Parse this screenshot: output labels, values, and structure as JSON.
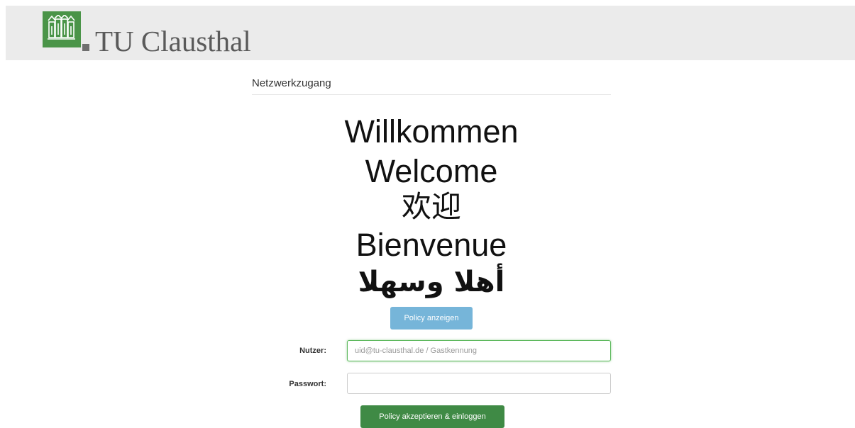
{
  "header": {
    "brand": "TU Clausthal",
    "logo_icon": "tu-clausthal-logo-icon",
    "logo_color": "#4a9448",
    "background": "#ebebeb"
  },
  "main": {
    "section_title": "Netzwerkzugang",
    "welcome": [
      "Willkommen",
      "Welcome",
      "欢迎",
      "Bienvenue",
      "أهلا وسهلا"
    ],
    "policy_button": "Policy anzeigen",
    "user_label": "Nutzer:",
    "user_placeholder": "uid@tu-clausthal.de / Gastkennung",
    "user_value": "",
    "password_label": "Passwort:",
    "password_value": "",
    "login_button": "Policy akzeptieren & einloggen"
  },
  "colors": {
    "policy_button": "#76b5d9",
    "login_button": "#3f8a45",
    "focus_border": "#5cb85c"
  }
}
